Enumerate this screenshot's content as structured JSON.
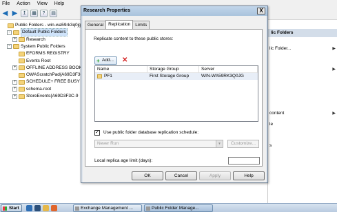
{
  "menubar": [
    "File",
    "Action",
    "View",
    "Help"
  ],
  "tree": {
    "items": [
      {
        "label": "Public Folders - win-wa59rk3q0jg.ad",
        "indent": 0,
        "expander": "",
        "selected": false,
        "icon": "folder"
      },
      {
        "label": "Default Public Folders",
        "indent": 1,
        "expander": "-",
        "selected": true,
        "icon": "folder"
      },
      {
        "label": "Research",
        "indent": 2,
        "expander": "+",
        "selected": false,
        "icon": "folder"
      },
      {
        "label": "System Public Folders",
        "indent": 1,
        "expander": "-",
        "selected": false,
        "icon": "folder"
      },
      {
        "label": "EFORMS REGISTRY",
        "indent": 2,
        "expander": "",
        "selected": false,
        "icon": "folder"
      },
      {
        "label": "Events Root",
        "indent": 2,
        "expander": "",
        "selected": false,
        "icon": "folder"
      },
      {
        "label": "OFFLINE ADDRESS BOOK",
        "indent": 2,
        "expander": "+",
        "selected": false,
        "icon": "folder"
      },
      {
        "label": "OWAScratchPad{A69D3F3C",
        "indent": 2,
        "expander": "",
        "selected": false,
        "icon": "folder"
      },
      {
        "label": "SCHEDULE+ FREE BUSY",
        "indent": 2,
        "expander": "+",
        "selected": false,
        "icon": "folder"
      },
      {
        "label": "schema-root",
        "indent": 2,
        "expander": "+",
        "selected": false,
        "icon": "folder"
      },
      {
        "label": "StoreEvents{A69D3F3C-9",
        "indent": 2,
        "expander": "+",
        "selected": false,
        "icon": "folder"
      }
    ]
  },
  "right_pane": {
    "header": "lic Folders",
    "items": [
      "lic Folder...",
      "",
      "content",
      "le",
      "s"
    ]
  },
  "dialog": {
    "title": "Research Properties",
    "close_label": "X",
    "tabs": [
      {
        "label": "General",
        "active": false
      },
      {
        "label": "Replication",
        "active": true
      },
      {
        "label": "Limits",
        "active": false
      }
    ],
    "intro_text": "Replicate content to these public stores:",
    "add_label": "Add...",
    "list": {
      "columns": [
        "Name",
        "Storage Group",
        "Server"
      ],
      "rows": [
        {
          "name": "PF1",
          "storage_group": "First Storage Group",
          "server": "WIN-WA59RK3Q0JG"
        }
      ]
    },
    "schedule_checkbox": {
      "label": "Use public folder database replication schedule:",
      "checked": true
    },
    "schedule_select": "Never Run",
    "customize_label": "Customize...",
    "age_limit_label": "Local replica age limit (days):",
    "age_limit_value": "",
    "buttons": {
      "ok": "OK",
      "cancel": "Cancel",
      "apply": "Apply",
      "help": "Help"
    }
  },
  "taskbar": {
    "start_label": "Start",
    "tasks": [
      {
        "label": "Exchange Management ...",
        "active": false
      },
      {
        "label": "Public Folder Manage...",
        "active": true
      }
    ]
  },
  "colors": {
    "dialog_title_bg": "#a9c3dd",
    "selected_row_bg": "#e8eef7",
    "remove_icon": "#d42020",
    "add_icon": "#1a9a1a"
  }
}
